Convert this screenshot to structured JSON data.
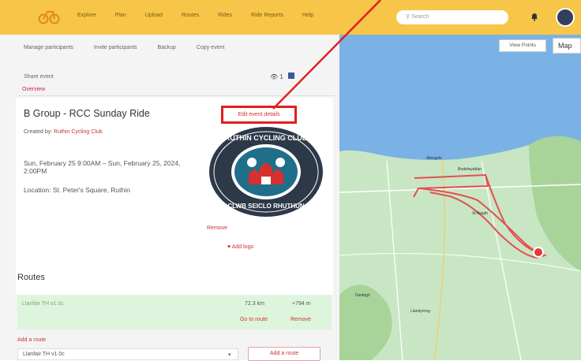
{
  "header": {
    "nav": [
      "Explore",
      "Plan",
      "Upload",
      "Routes",
      "Rides",
      "Ride Reports",
      "Help"
    ],
    "search_placeholder": "Search"
  },
  "event": {
    "subnav": [
      "Manage participants",
      "Invite participants",
      "Backup",
      "Copy event"
    ],
    "share_label": "Share event",
    "counts": "1",
    "tab": "Overview",
    "title": "B Group - RCC Sunday Ride",
    "created_by_prefix": "Created by:",
    "created_by": "Ruthin Cycling Club",
    "dates": "Sun, February 25 9:00AM – Sun, February 25, 2024, 2:00PM",
    "location": "Location: St. Peter's Square, Ruthin",
    "edit_button": "Edit event details",
    "remove_logo": "Remove",
    "add_logo": "Add logo",
    "logo_text_top": "RUTHIN CYCLING CLUB",
    "logo_text_bottom": "CLWB SEICLO RHUTHUN"
  },
  "routes": {
    "title": "Routes",
    "items": [
      {
        "name": "Llanfair TH v1.0c",
        "distance": "72.3 km",
        "elevation": "+794 m",
        "go": "Go to route",
        "remove": "Remove"
      }
    ],
    "add_link": "Add a route",
    "select_value": "Llanfair TH v1.0c",
    "add_button": "Add a route"
  },
  "map": {
    "view_points": "View Points",
    "map_button": "Map",
    "labels": [
      "Abergele",
      "Bodelwyddan",
      "St Asaph",
      "Llandyrnog",
      "Denbigh"
    ]
  },
  "colors": {
    "header": "#f7c548",
    "accent": "#c33333",
    "highlight": "#e02020",
    "route": "#e05050"
  }
}
